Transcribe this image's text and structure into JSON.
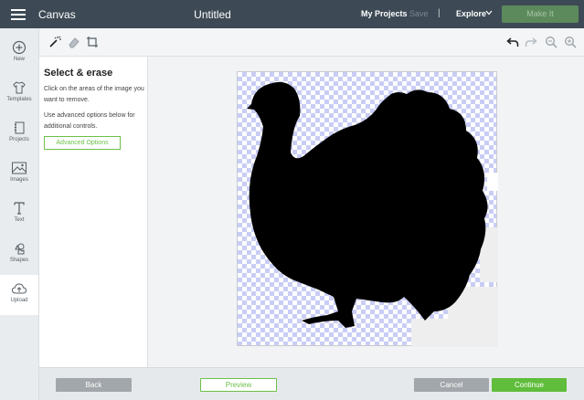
{
  "header": {
    "app_title": "Canvas",
    "document_title": "Untitled",
    "my_projects": "My Projects",
    "save": "Save",
    "divider": "|",
    "explore": "Explore",
    "make_it": "Make It"
  },
  "sidebar": {
    "items": [
      {
        "label": "New",
        "icon": "plus-circle-icon"
      },
      {
        "label": "Templates",
        "icon": "tshirt-icon"
      },
      {
        "label": "Projects",
        "icon": "notebook-icon"
      },
      {
        "label": "Images",
        "icon": "image-icon"
      },
      {
        "label": "Text",
        "icon": "text-icon"
      },
      {
        "label": "Shapes",
        "icon": "shapes-icon"
      },
      {
        "label": "Upload",
        "icon": "cloud-upload-icon"
      }
    ],
    "active": "Upload"
  },
  "tools": {
    "left": [
      "magic-wand-icon",
      "eraser-icon",
      "crop-icon"
    ],
    "right": [
      "undo-icon",
      "redo-icon",
      "zoom-out-icon",
      "zoom-in-icon"
    ]
  },
  "panel": {
    "title": "Select & erase",
    "text1": "Click on the areas of the image you want to remove.",
    "text2": "Use advanced options below for additional controls.",
    "advanced_button": "Advanced Options"
  },
  "footer": {
    "back": "Back",
    "preview": "Preview",
    "cancel": "Cancel",
    "continue": "Continue"
  },
  "colors": {
    "topbar": "#3d4a55",
    "accent_green": "#5fbd3b",
    "checker": "#c9cdf5"
  }
}
